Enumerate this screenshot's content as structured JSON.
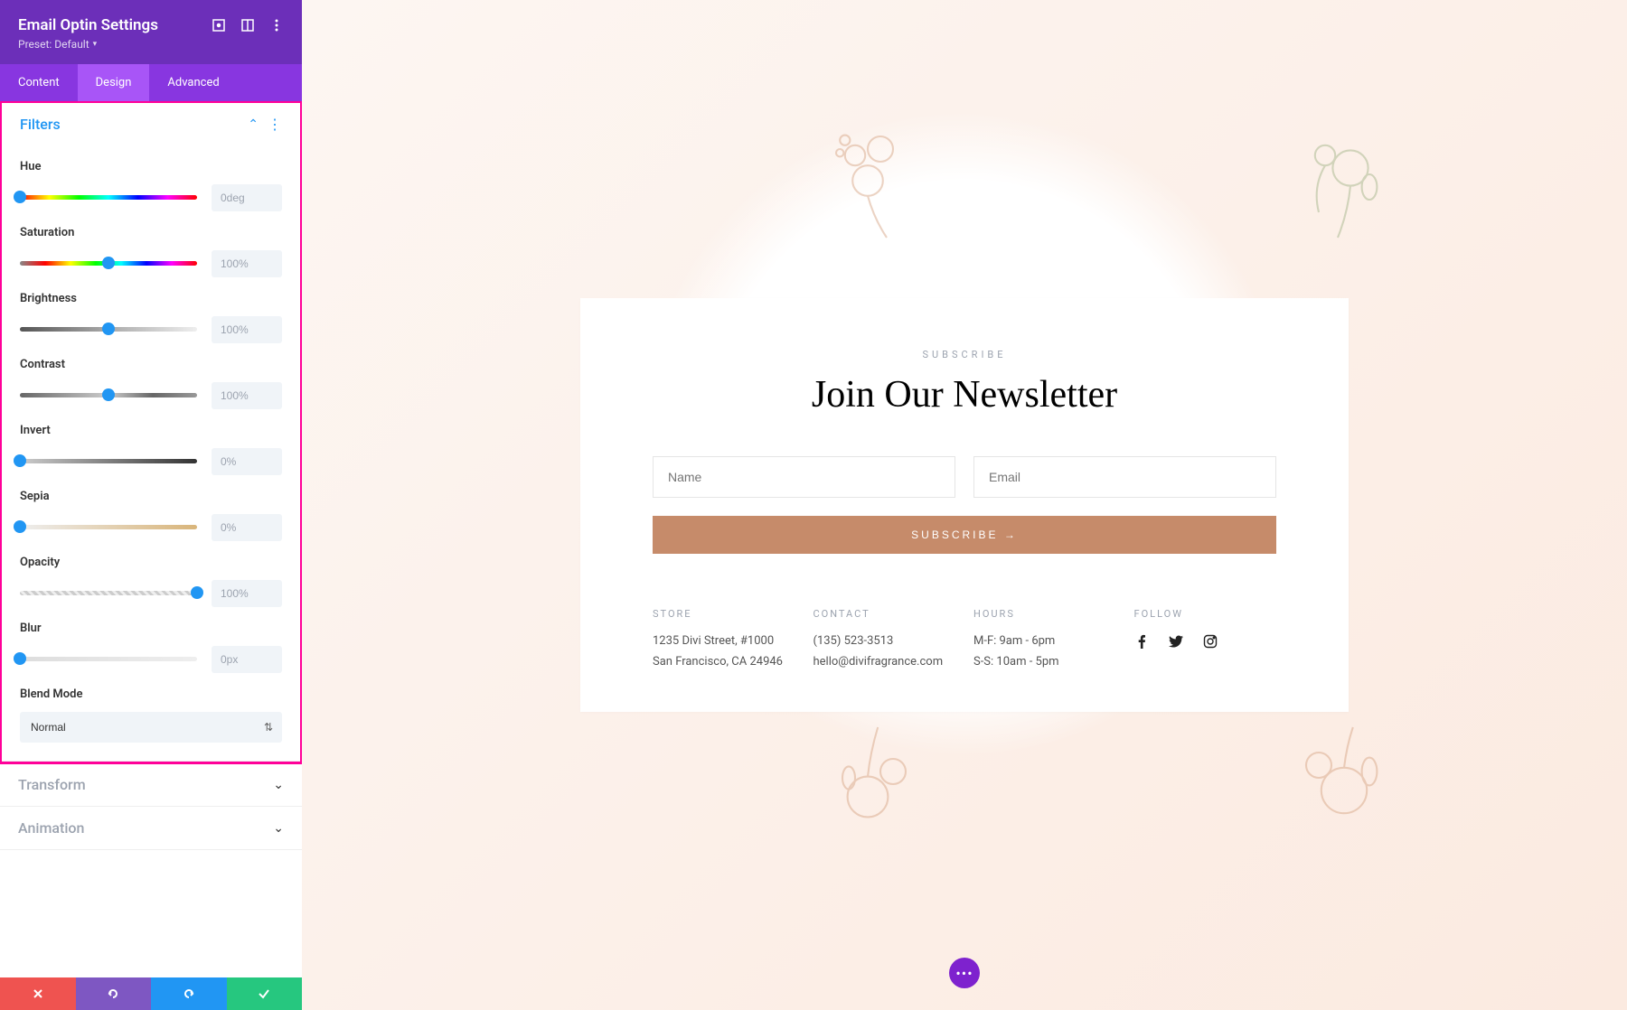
{
  "panel": {
    "title": "Email Optin Settings",
    "preset": "Preset: Default"
  },
  "tabs": {
    "content": "Content",
    "design": "Design",
    "advanced": "Advanced"
  },
  "section_filters": "Filters",
  "section_transform": "Transform",
  "section_animation": "Animation",
  "hue": {
    "label": "Hue",
    "value": "0deg",
    "pos": 0
  },
  "saturation": {
    "label": "Saturation",
    "value": "100%",
    "pos": 50
  },
  "brightness": {
    "label": "Brightness",
    "value": "100%",
    "pos": 50
  },
  "contrast": {
    "label": "Contrast",
    "value": "100%",
    "pos": 50
  },
  "invert": {
    "label": "Invert",
    "value": "0%",
    "pos": 0
  },
  "sepia": {
    "label": "Sepia",
    "value": "0%",
    "pos": 0
  },
  "opacity": {
    "label": "Opacity",
    "value": "100%",
    "pos": 100
  },
  "blur": {
    "label": "Blur",
    "value": "0px",
    "pos": 0
  },
  "blend": {
    "label": "Blend Mode",
    "value": "Normal"
  },
  "preview": {
    "eyebrow": "SUBSCRIBE",
    "title": "Join Our Newsletter",
    "name_ph": "Name",
    "email_ph": "Email",
    "submit": "SUBSCRIBE →",
    "store_h": "STORE",
    "store_l1": "1235 Divi Street, #1000",
    "store_l2": "San Francisco, CA 24946",
    "contact_h": "CONTACT",
    "contact_l1": "(135) 523-3513",
    "contact_l2": "hello@divifragrance.com",
    "hours_h": "HOURS",
    "hours_l1": "M-F: 9am - 6pm",
    "hours_l2": "S-S: 10am - 5pm",
    "follow_h": "FOLLOW"
  }
}
